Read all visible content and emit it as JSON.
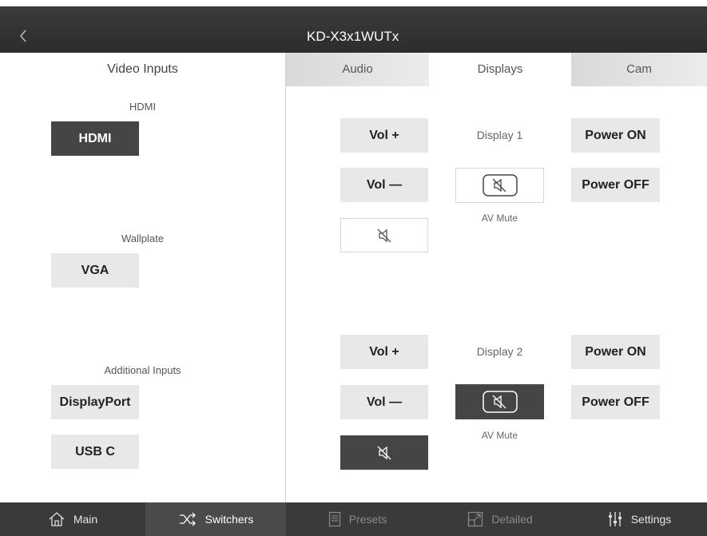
{
  "header": {
    "title": "KD-X3x1WUTx",
    "back_glyph": "‹"
  },
  "left_panel": {
    "heading": "Video Inputs",
    "groups": [
      {
        "label": "HDMI",
        "buttons": [
          "HDMI"
        ]
      },
      {
        "label": "Wallplate",
        "buttons": [
          "VGA"
        ]
      },
      {
        "label": "Additional Inputs",
        "buttons": [
          "DisplayPort",
          "USB C"
        ]
      }
    ],
    "selected": "HDMI"
  },
  "tabs": [
    {
      "label": "Audio",
      "active": false
    },
    {
      "label": "Displays",
      "active": true
    },
    {
      "label": "Cam",
      "active": false
    }
  ],
  "displays": [
    {
      "vol_up": "Vol +",
      "vol_down": "Vol —",
      "name": "Display 1",
      "power_on": "Power ON",
      "power_off": "Power OFF",
      "av_mute_label": "AV Mute",
      "muted": false
    },
    {
      "vol_up": "Vol +",
      "vol_down": "Vol —",
      "name": "Display 2",
      "power_on": "Power ON",
      "power_off": "Power OFF",
      "av_mute_label": "AV Mute",
      "muted": true
    }
  ],
  "bottom_nav": [
    {
      "label": "Main",
      "icon": "home-icon",
      "active": false,
      "disabled": false
    },
    {
      "label": "Switchers",
      "icon": "shuffle-icon",
      "active": true,
      "disabled": false
    },
    {
      "label": "Presets",
      "icon": "document-icon",
      "active": false,
      "disabled": true
    },
    {
      "label": "Detailed",
      "icon": "expand-icon",
      "active": false,
      "disabled": true
    },
    {
      "label": "Settings",
      "icon": "sliders-icon",
      "active": false,
      "disabled": false
    }
  ],
  "colors": {
    "titlebar": "#333333",
    "button_light": "#e8e8e8",
    "button_dark": "#454545",
    "bottom_bar": "#3a3a3a",
    "bottom_active": "#4a4a4a"
  }
}
